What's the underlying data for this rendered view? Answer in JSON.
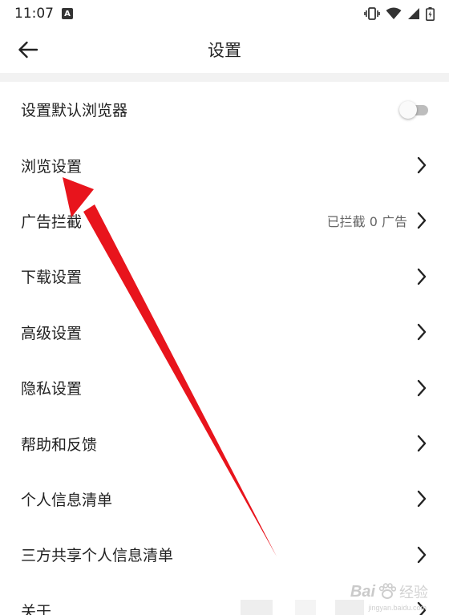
{
  "status_bar": {
    "time": "11:07",
    "notification_glyph": "A",
    "icons": [
      "vibrate-icon",
      "wifi-icon",
      "signal-icon",
      "battery-icon"
    ]
  },
  "app_bar": {
    "title": "设置",
    "back_icon": "arrow-left-icon"
  },
  "settings": {
    "items": [
      {
        "label": "设置默认浏览器",
        "control": "toggle",
        "toggle_on": false
      },
      {
        "label": "浏览设置",
        "control": "chevron"
      },
      {
        "label": "广告拦截",
        "control": "chevron",
        "value": "已拦截 0 广告"
      },
      {
        "label": "下载设置",
        "control": "chevron"
      },
      {
        "label": "高级设置",
        "control": "chevron"
      },
      {
        "label": "隐私设置",
        "control": "chevron"
      },
      {
        "label": "帮助和反馈",
        "control": "chevron"
      },
      {
        "label": "个人信息清单",
        "control": "chevron"
      },
      {
        "label": "三方共享个人信息清单",
        "control": "chevron"
      },
      {
        "label": "关于",
        "control": "chevron"
      }
    ]
  },
  "annotation": {
    "type": "arrow",
    "color": "#e8141c",
    "points_to": "浏览设置"
  },
  "watermark": {
    "brand": "Bai",
    "brand_suffix": "经验",
    "url": "jingyan.baidu.com"
  },
  "colors": {
    "text": "#222222",
    "secondary_text": "#666666",
    "divider_band": "#f2f2f2",
    "toggle_off_track": "#bdbdbd"
  }
}
